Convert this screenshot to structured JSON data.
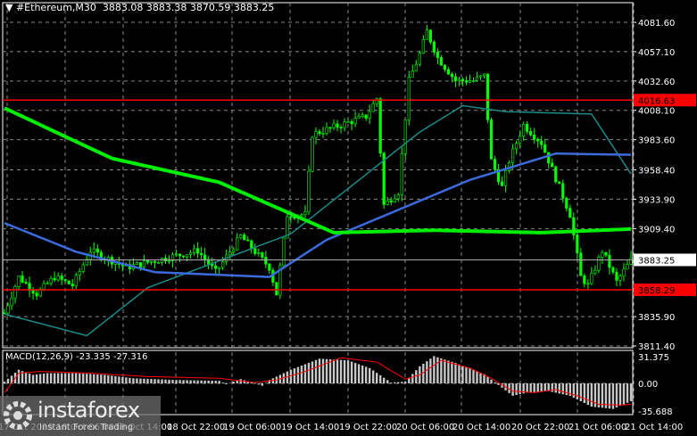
{
  "header": {
    "symbol": "#Ethereum,M30",
    "ohlc": "3883.08 3883.38 3870.59 3883.25"
  },
  "macd_label": "MACD(12,26,9) -23.335 -27.316",
  "logo": {
    "name": "instaforex",
    "tagline": "Instant Forex Trading"
  },
  "colors": {
    "bull": "#00ff00",
    "line_red": "#ff0000",
    "ma200": "#00ee00",
    "ma_blue": "#3b6bdc",
    "ma_teal": "#1a8a8a",
    "hist": "#c8c8c8"
  },
  "chart_data": {
    "type": "candlestick",
    "price_axis": {
      "ticks": [
        "4081.60",
        "4057.10",
        "4032.60",
        "4008.10",
        "3983.60",
        "3958.40",
        "3933.90",
        "3909.40",
        "3883.25",
        "3835.90",
        "3811.40"
      ],
      "range": [
        3811.4,
        4081.6
      ]
    },
    "labels": {
      "resistance": "4016.63",
      "support": "3858.29",
      "current": "3883.25"
    },
    "levels": {
      "resistance": 4016.63,
      "support": 3858.29,
      "current": 3883.25
    },
    "macd_axis": {
      "ticks": [
        "31.375",
        "0.00",
        "-35.688"
      ],
      "range": [
        -35.688,
        31.375
      ]
    },
    "time_labels": [
      "17 Oct 2025",
      "18 Oct 06:00",
      "18 Oct 14:00",
      "18 Oct 22:00",
      "19 Oct 06:00",
      "19 Oct 14:00",
      "19 Oct 22:00",
      "20 Oct 06:00",
      "20 Oct 14:00",
      "20 Oct 22:00",
      "21 Oct 06:00",
      "21 Oct 14:00"
    ],
    "close_path": [
      [
        0,
        3839
      ],
      [
        4,
        3869
      ],
      [
        9,
        3855
      ],
      [
        14,
        3869
      ],
      [
        19,
        3862
      ],
      [
        24,
        3891
      ],
      [
        34,
        3877
      ],
      [
        44,
        3884
      ],
      [
        54,
        3891
      ],
      [
        59,
        3873
      ],
      [
        66,
        3903
      ],
      [
        74,
        3877
      ],
      [
        76,
        3855
      ],
      [
        79,
        3921
      ],
      [
        84,
        3921
      ],
      [
        86,
        3988
      ],
      [
        94,
        3996
      ],
      [
        101,
        4003
      ],
      [
        104,
        4018
      ],
      [
        106,
        3929
      ],
      [
        110,
        3940
      ],
      [
        113,
        4033
      ],
      [
        116,
        4055
      ],
      [
        118,
        4074
      ],
      [
        121,
        4052
      ],
      [
        126,
        4033
      ],
      [
        131,
        4033
      ],
      [
        134,
        4037
      ],
      [
        136,
        3966
      ],
      [
        139,
        3944
      ],
      [
        141,
        3966
      ],
      [
        145,
        3996
      ],
      [
        150,
        3981
      ],
      [
        155,
        3944
      ],
      [
        158,
        3921
      ],
      [
        161,
        3869
      ],
      [
        163,
        3862
      ],
      [
        167,
        3891
      ],
      [
        171,
        3865
      ],
      [
        175,
        3883
      ]
    ],
    "ma200": [
      [
        0,
        4010
      ],
      [
        30,
        3968
      ],
      [
        60,
        3948
      ],
      [
        92,
        3906
      ],
      [
        120,
        3908
      ],
      [
        150,
        3906
      ],
      [
        175,
        3909
      ]
    ],
    "ma_blue": [
      [
        0,
        3914
      ],
      [
        20,
        3890
      ],
      [
        42,
        3873
      ],
      [
        74,
        3869
      ],
      [
        90,
        3900
      ],
      [
        130,
        3950
      ],
      [
        154,
        3972
      ],
      [
        175,
        3971
      ]
    ],
    "ma_teal": [
      [
        0,
        3838
      ],
      [
        23,
        3820
      ],
      [
        40,
        3860
      ],
      [
        80,
        3905
      ],
      [
        116,
        3990
      ],
      [
        128,
        4012
      ],
      [
        140,
        4007
      ],
      [
        164,
        4005
      ],
      [
        175,
        3955
      ]
    ],
    "macd_hist": [
      [
        0,
        2
      ],
      [
        4,
        16
      ],
      [
        8,
        10
      ],
      [
        12,
        12
      ],
      [
        20,
        12
      ],
      [
        28,
        10
      ],
      [
        36,
        6
      ],
      [
        48,
        4
      ],
      [
        60,
        3
      ],
      [
        62,
        -1
      ],
      [
        66,
        5
      ],
      [
        70,
        0
      ],
      [
        72,
        -3
      ],
      [
        74,
        4
      ],
      [
        80,
        16
      ],
      [
        88,
        29
      ],
      [
        96,
        27
      ],
      [
        102,
        18
      ],
      [
        108,
        1
      ],
      [
        112,
        2
      ],
      [
        116,
        20
      ],
      [
        120,
        32
      ],
      [
        126,
        24
      ],
      [
        134,
        11
      ],
      [
        138,
        -2
      ],
      [
        142,
        -16
      ],
      [
        146,
        -12
      ],
      [
        152,
        -10
      ],
      [
        158,
        -16
      ],
      [
        164,
        -30
      ],
      [
        170,
        -33
      ],
      [
        175,
        -23
      ]
    ],
    "macd_signal": [
      [
        0,
        -12
      ],
      [
        4,
        12
      ],
      [
        10,
        14
      ],
      [
        24,
        12
      ],
      [
        40,
        8
      ],
      [
        60,
        6
      ],
      [
        70,
        1
      ],
      [
        76,
        4
      ],
      [
        84,
        14
      ],
      [
        94,
        30
      ],
      [
        104,
        25
      ],
      [
        112,
        5
      ],
      [
        116,
        10
      ],
      [
        122,
        27
      ],
      [
        130,
        18
      ],
      [
        136,
        6
      ],
      [
        142,
        -10
      ],
      [
        148,
        -12
      ],
      [
        154,
        -8
      ],
      [
        160,
        -16
      ],
      [
        166,
        -27
      ],
      [
        172,
        -28
      ],
      [
        175,
        -27
      ]
    ]
  }
}
